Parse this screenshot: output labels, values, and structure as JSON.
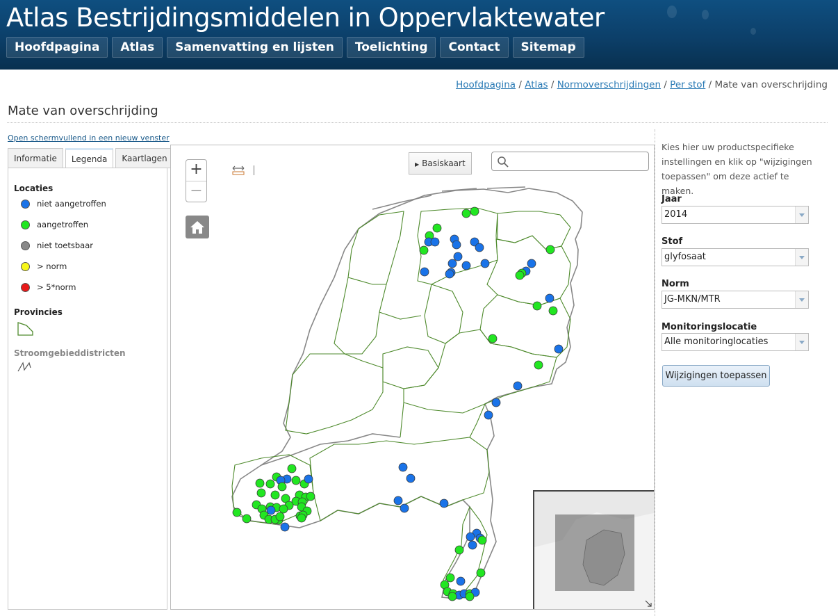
{
  "site": {
    "title": "Atlas Bestrijdingsmiddelen in Oppervlaktewater",
    "nav": [
      "Hoofdpagina",
      "Atlas",
      "Samenvatting en lijsten",
      "Toelichting",
      "Contact",
      "Sitemap"
    ]
  },
  "breadcrumb": {
    "links": [
      "Hoofdpagina",
      "Atlas",
      "Normoverschrijdingen",
      "Per stof"
    ],
    "separator": " / ",
    "current": "Mate van overschrijding"
  },
  "page": {
    "title": "Mate van overschrijding",
    "fullscreen_link": "Open schermvullend in een nieuw venster"
  },
  "tabs": [
    "Informatie",
    "Legenda",
    "Kaartlagen"
  ],
  "legend": {
    "locations_title": "Locaties",
    "items": [
      {
        "label": "niet aangetroffen",
        "color": "#1a73e8"
      },
      {
        "label": "aangetroffen",
        "color": "#22e622"
      },
      {
        "label": "niet toetsbaar",
        "color": "#888888"
      },
      {
        "label": "> norm",
        "color": "#f7f71a"
      },
      {
        "label": "> 5*norm",
        "color": "#e81a1a"
      }
    ],
    "provinces_title": "Provincies",
    "districts_title": "Stroomgebieddistricten"
  },
  "map": {
    "zoom_in": "+",
    "zoom_out": "−",
    "basemap_label": "Basiskaart",
    "search_placeholder": "",
    "colors": {
      "not_found": "#1a73e8",
      "found": "#22e622",
      "province": "#4e8a2c",
      "coast": "#888888"
    }
  },
  "settings": {
    "intro": "Kies hier uw productspecifieke instellingen en klik op \"wijzigingen toepassen\" om deze actief te maken.",
    "fields": [
      {
        "label": "Jaar",
        "value": "2014"
      },
      {
        "label": "Stof",
        "value": "glyfosaat"
      },
      {
        "label": "Norm",
        "value": "JG-MKN/MTR"
      },
      {
        "label": "Monitoringslocatie",
        "value": "Alle monitoringlocaties"
      }
    ],
    "apply_label": "Wijzigingen toepassen"
  }
}
